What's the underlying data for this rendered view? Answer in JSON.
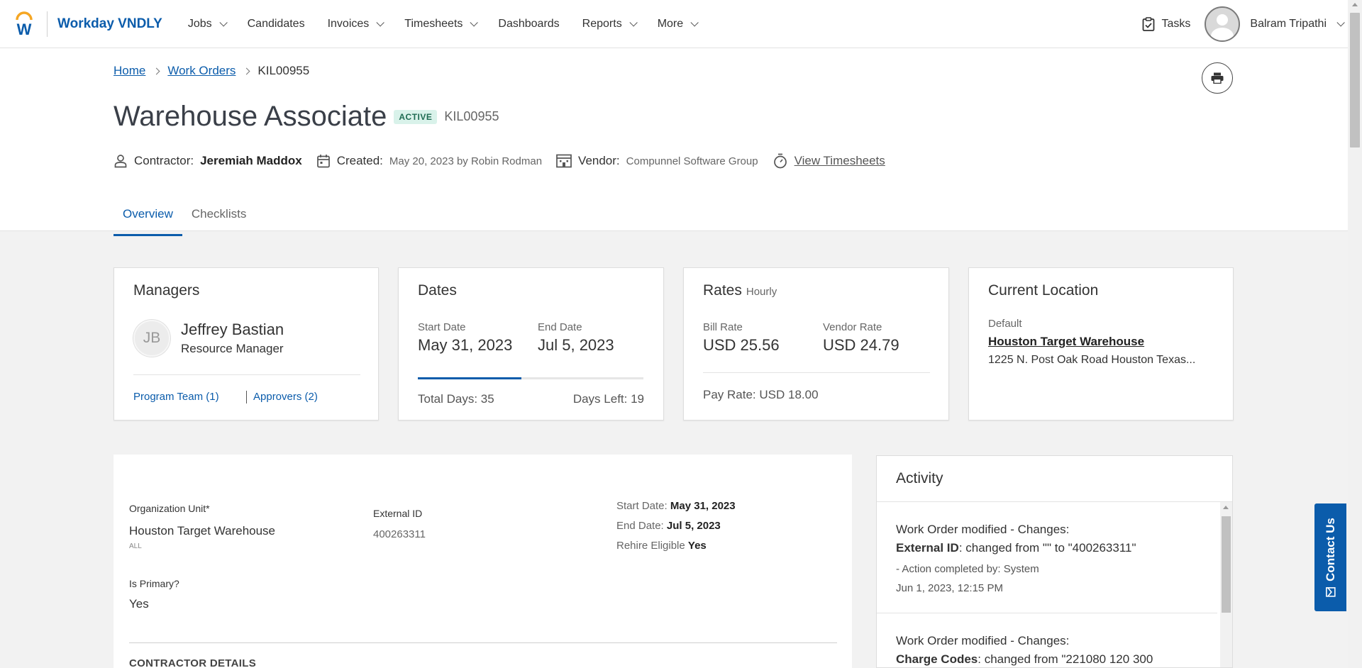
{
  "nav": {
    "brand": "Workday VNDLY",
    "items": [
      {
        "label": "Jobs",
        "dropdown": true
      },
      {
        "label": "Candidates",
        "dropdown": false
      },
      {
        "label": "Invoices",
        "dropdown": true
      },
      {
        "label": "Timesheets",
        "dropdown": true
      },
      {
        "label": "Dashboards",
        "dropdown": false
      },
      {
        "label": "Reports",
        "dropdown": true
      },
      {
        "label": "More",
        "dropdown": true
      }
    ],
    "tasks_label": "Tasks",
    "user_name": "Balram Tripathi"
  },
  "breadcrumb": {
    "home": "Home",
    "work_orders": "Work Orders",
    "current": "KIL00955"
  },
  "header": {
    "title": "Warehouse Associate",
    "status": "ACTIVE",
    "id": "KIL00955",
    "contractor_label": "Contractor:",
    "contractor_value": "Jeremiah Maddox",
    "created_label": "Created:",
    "created_value": "May 20, 2023 by Robin Rodman",
    "vendor_label": "Vendor:",
    "vendor_value": "Compunnel Software Group",
    "timesheets_link": "View Timesheets"
  },
  "tabs": [
    {
      "label": "Overview",
      "active": true
    },
    {
      "label": "Checklists",
      "active": false
    }
  ],
  "managers": {
    "title": "Managers",
    "initials": "JB",
    "name": "Jeffrey Bastian",
    "role": "Resource Manager",
    "program_team": "Program Team (1)",
    "approvers": "Approvers (2)"
  },
  "dates": {
    "title": "Dates",
    "start_label": "Start Date",
    "start_value": "May 31, 2023",
    "end_label": "End Date",
    "end_value": "Jul 5, 2023",
    "progress_fraction": 0.46,
    "total_days": "Total Days: 35",
    "days_left": "Days Left: 19"
  },
  "rates": {
    "title": "Rates",
    "subtitle": "Hourly",
    "bill_label": "Bill Rate",
    "bill_value": "USD 25.56",
    "vendor_label": "Vendor Rate",
    "vendor_value": "USD 24.79",
    "pay_rate": "Pay Rate: USD 18.00"
  },
  "location": {
    "title": "Current Location",
    "default_label": "Default",
    "name": "Houston Target Warehouse",
    "address": "1225 N. Post Oak Road Houston Texas..."
  },
  "details": {
    "org_unit_label": "Organization Unit*",
    "org_unit_value": "Houston Target Warehouse",
    "org_unit_scope": "ALL",
    "external_id_label": "External ID",
    "external_id_value": "400263311",
    "start_label": "Start Date:",
    "start_value": "May 31, 2023",
    "end_label": "End Date:",
    "end_value": "Jul 5, 2023",
    "rehire_label": "Rehire Eligible",
    "rehire_value": "Yes",
    "primary_label": "Is Primary?",
    "primary_value": "Yes",
    "section_contractor": "CONTRACTOR DETAILS"
  },
  "activity": {
    "title": "Activity",
    "items": [
      {
        "line1": "Work Order modified - Changes:",
        "field": "External ID",
        "change": ": changed from \"\" to \"400263311\"",
        "by": "- Action completed by: System",
        "time": "Jun 1, 2023, 12:15 PM"
      },
      {
        "line1": "Work Order modified - Changes:",
        "field": "Charge Codes",
        "change": ": changed from \"221080 120 300",
        "by": "",
        "time": ""
      }
    ]
  },
  "contact_us": "Contact Us",
  "colors": {
    "accent": "#0b5cab",
    "badge_bg": "#d9f2ea",
    "badge_text": "#1f6b52"
  }
}
